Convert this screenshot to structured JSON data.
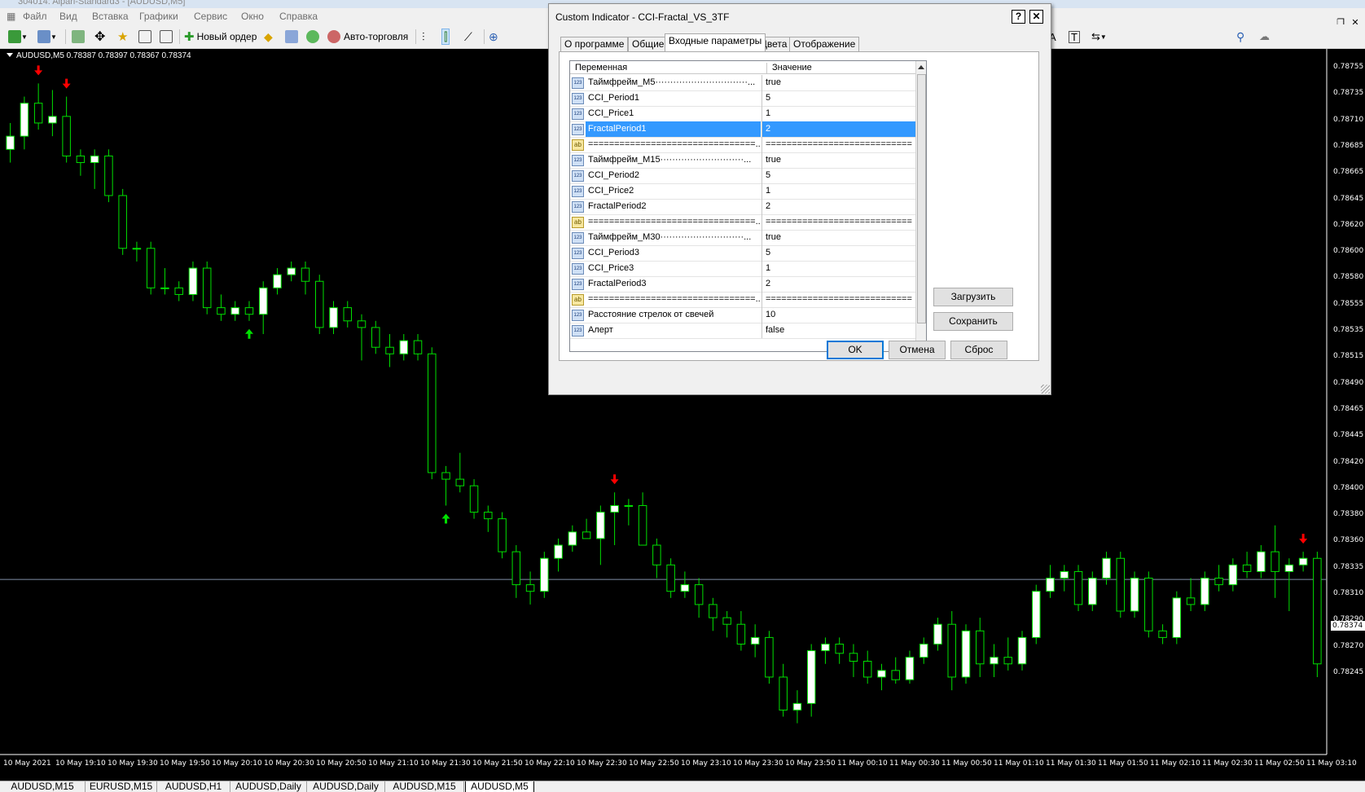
{
  "window": {
    "title": "304014: Alpari-Standard3 - [AUDUSD,M5]"
  },
  "menu": [
    "Файл",
    "Вид",
    "Вставка",
    "Графики",
    "Сервис",
    "Окно",
    "Справка"
  ],
  "toolbar": {
    "new_order": "Новый ордер",
    "auto_trading": "Авто-торговля"
  },
  "chart": {
    "symbol_label": "AUDUSD,M5  0.78387 0.78397 0.78367 0.78374",
    "bid": "0.78374",
    "colors": {
      "bull_body": "#ffffff",
      "bear_body": "#000000",
      "wick": "#00e000",
      "up_arrow": "#00e000",
      "down_arrow": "#ff0000",
      "bid_line": "#7f8fa8"
    },
    "price_labels": [
      "0.78755",
      "0.78735",
      "0.78710",
      "0.78685",
      "0.78665",
      "0.78645",
      "0.78620",
      "0.78600",
      "0.78580",
      "0.78555",
      "0.78535",
      "0.78515",
      "0.78490",
      "0.78465",
      "0.78445",
      "0.78420",
      "0.78400",
      "0.78380",
      "0.78360",
      "0.78335",
      "0.78310",
      "0.78290",
      "0.78270",
      "0.78245"
    ],
    "time_labels": [
      "10 May 2021",
      "10 May 19:10",
      "10 May 19:30",
      "10 May 19:50",
      "10 May 20:10",
      "10 May 20:30",
      "10 May 20:50",
      "10 May 21:10",
      "10 May 21:30",
      "10 May 21:50",
      "10 May 22:10",
      "10 May 22:30",
      "10 May 22:50",
      "10 May 23:10",
      "10 May 23:30",
      "10 May 23:50",
      "11 May 00:10",
      "11 May 00:30",
      "11 May 00:50",
      "11 May 01:10",
      "11 May 01:30",
      "11 May 01:50",
      "11 May 02:10",
      "11 May 02:30",
      "11 May 02:50",
      "11 May 03:10"
    ]
  },
  "chart_data": {
    "type": "candlestick",
    "symbol": "AUDUSD",
    "timeframe": "M5",
    "ylim": [
      0.78245,
      0.7877
    ],
    "candles": [
      [
        0.787,
        0.7872,
        0.7869,
        0.7871
      ],
      [
        0.7871,
        0.7874,
        0.787,
        0.78735
      ],
      [
        0.78735,
        0.7875,
        0.78715,
        0.7872
      ],
      [
        0.7872,
        0.78745,
        0.7871,
        0.78725
      ],
      [
        0.78725,
        0.7874,
        0.7869,
        0.78695
      ],
      [
        0.78695,
        0.787,
        0.7868,
        0.7869
      ],
      [
        0.7869,
        0.787,
        0.7867,
        0.78695
      ],
      [
        0.78695,
        0.787,
        0.7866,
        0.78665
      ],
      [
        0.78665,
        0.7867,
        0.7862,
        0.78625
      ],
      [
        0.78625,
        0.7863,
        0.78615,
        0.78625
      ],
      [
        0.78625,
        0.7863,
        0.7859,
        0.78595
      ],
      [
        0.78595,
        0.7861,
        0.7859,
        0.78595
      ],
      [
        0.78595,
        0.786,
        0.78585,
        0.7859
      ],
      [
        0.7859,
        0.78615,
        0.78585,
        0.7861
      ],
      [
        0.7861,
        0.78615,
        0.78575,
        0.7858
      ],
      [
        0.7858,
        0.7859,
        0.7857,
        0.78575
      ],
      [
        0.78575,
        0.78585,
        0.7857,
        0.7858
      ],
      [
        0.7858,
        0.78585,
        0.7857,
        0.78575
      ],
      [
        0.78575,
        0.786,
        0.7856,
        0.78595
      ],
      [
        0.78595,
        0.7861,
        0.7859,
        0.78605
      ],
      [
        0.78605,
        0.78615,
        0.786,
        0.7861
      ],
      [
        0.7861,
        0.78615,
        0.7859,
        0.786
      ],
      [
        0.786,
        0.78605,
        0.7856,
        0.78565
      ],
      [
        0.78565,
        0.78585,
        0.7856,
        0.7858
      ],
      [
        0.7858,
        0.78585,
        0.78565,
        0.7857
      ],
      [
        0.7857,
        0.78575,
        0.7854,
        0.78565
      ],
      [
        0.78565,
        0.7857,
        0.78545,
        0.7855
      ],
      [
        0.7855,
        0.7856,
        0.78535,
        0.78545
      ],
      [
        0.78545,
        0.7856,
        0.7854,
        0.78555
      ],
      [
        0.78555,
        0.7856,
        0.7854,
        0.78545
      ],
      [
        0.78545,
        0.7855,
        0.7845,
        0.78455
      ],
      [
        0.78455,
        0.7846,
        0.7843,
        0.7845
      ],
      [
        0.7845,
        0.7847,
        0.7844,
        0.78445
      ],
      [
        0.78445,
        0.7845,
        0.7842,
        0.78425
      ],
      [
        0.78425,
        0.7843,
        0.7841,
        0.7842
      ],
      [
        0.7842,
        0.78425,
        0.7839,
        0.78395
      ],
      [
        0.78395,
        0.784,
        0.7836,
        0.7837
      ],
      [
        0.7837,
        0.7838,
        0.78355,
        0.78365
      ],
      [
        0.78365,
        0.78395,
        0.7836,
        0.7839
      ],
      [
        0.7839,
        0.78405,
        0.7838,
        0.784
      ],
      [
        0.784,
        0.78415,
        0.78395,
        0.7841
      ],
      [
        0.7841,
        0.7842,
        0.78405,
        0.78405
      ],
      [
        0.78405,
        0.7843,
        0.78385,
        0.78425
      ],
      [
        0.78425,
        0.7844,
        0.784,
        0.7843
      ],
      [
        0.7843,
        0.78435,
        0.78415,
        0.7843
      ],
      [
        0.7843,
        0.7844,
        0.78405,
        0.784
      ],
      [
        0.784,
        0.78405,
        0.78375,
        0.78385
      ],
      [
        0.78385,
        0.7839,
        0.7836,
        0.78365
      ],
      [
        0.78365,
        0.7838,
        0.7836,
        0.7837
      ],
      [
        0.7837,
        0.78375,
        0.78345,
        0.78355
      ],
      [
        0.78355,
        0.7836,
        0.78335,
        0.78345
      ],
      [
        0.78345,
        0.7835,
        0.7833,
        0.7834
      ],
      [
        0.7834,
        0.7835,
        0.7832,
        0.78325
      ],
      [
        0.78325,
        0.7834,
        0.78315,
        0.7833
      ],
      [
        0.7833,
        0.78335,
        0.78295,
        0.783
      ],
      [
        0.783,
        0.7831,
        0.7827,
        0.78275
      ],
      [
        0.78275,
        0.7829,
        0.78265,
        0.7828
      ],
      [
        0.7828,
        0.78325,
        0.7827,
        0.7832
      ],
      [
        0.7832,
        0.7833,
        0.7831,
        0.78325
      ],
      [
        0.78325,
        0.7833,
        0.7831,
        0.78318
      ],
      [
        0.78318,
        0.78325,
        0.783,
        0.78312
      ],
      [
        0.78312,
        0.7832,
        0.78295,
        0.783
      ],
      [
        0.783,
        0.7831,
        0.7829,
        0.78305
      ],
      [
        0.78305,
        0.78315,
        0.78295,
        0.78298
      ],
      [
        0.78298,
        0.7832,
        0.78295,
        0.78315
      ],
      [
        0.78315,
        0.7833,
        0.7831,
        0.78325
      ],
      [
        0.78325,
        0.78345,
        0.7832,
        0.7834
      ],
      [
        0.7834,
        0.7835,
        0.7829,
        0.783
      ],
      [
        0.783,
        0.7834,
        0.78295,
        0.78335
      ],
      [
        0.78335,
        0.78345,
        0.783,
        0.7831
      ],
      [
        0.7831,
        0.78325,
        0.783,
        0.78315
      ],
      [
        0.78315,
        0.7833,
        0.78305,
        0.7831
      ],
      [
        0.7831,
        0.78335,
        0.78305,
        0.7833
      ],
      [
        0.7833,
        0.7837,
        0.78325,
        0.78365
      ],
      [
        0.78365,
        0.78385,
        0.7836,
        0.78375
      ],
      [
        0.78375,
        0.78385,
        0.78365,
        0.7838
      ],
      [
        0.7838,
        0.78385,
        0.7835,
        0.78355
      ],
      [
        0.78355,
        0.7838,
        0.7835,
        0.78375
      ],
      [
        0.78375,
        0.78395,
        0.7837,
        0.7839
      ],
      [
        0.7839,
        0.78395,
        0.78345,
        0.7835
      ],
      [
        0.7835,
        0.7838,
        0.78345,
        0.78375
      ],
      [
        0.78375,
        0.7838,
        0.7833,
        0.78335
      ],
      [
        0.78335,
        0.7834,
        0.78325,
        0.7833
      ],
      [
        0.7833,
        0.78365,
        0.78325,
        0.7836
      ],
      [
        0.7836,
        0.78375,
        0.7835,
        0.78355
      ],
      [
        0.78355,
        0.7838,
        0.7835,
        0.78375
      ],
      [
        0.78375,
        0.78385,
        0.78365,
        0.7837
      ],
      [
        0.7837,
        0.7839,
        0.78365,
        0.78385
      ],
      [
        0.78385,
        0.78395,
        0.78375,
        0.7838
      ],
      [
        0.7838,
        0.784,
        0.78375,
        0.78395
      ],
      [
        0.78395,
        0.78415,
        0.7836,
        0.7838
      ],
      [
        0.7838,
        0.7839,
        0.7835,
        0.78385
      ],
      [
        0.78385,
        0.78395,
        0.7838,
        0.7839
      ],
      [
        0.7839,
        0.78395,
        0.783,
        0.7831
      ]
    ],
    "signals": [
      {
        "type": "down",
        "index": 2
      },
      {
        "type": "down",
        "index": 4
      },
      {
        "type": "up",
        "index": 17
      },
      {
        "type": "up",
        "index": 31
      },
      {
        "type": "down",
        "index": 43
      },
      {
        "type": "down",
        "index": 92
      }
    ]
  },
  "dialog": {
    "title": "Custom Indicator - CCI-Fractal_VS_3TF",
    "help_btn": "?",
    "close_btn": "✕",
    "tabs": [
      "О программе",
      "Общие",
      "Входные параметры",
      "Цвета",
      "Отображение"
    ],
    "active_tab": 2,
    "col_var": "Переменная",
    "col_val": "Значение",
    "rows": [
      {
        "icon": "123",
        "name": "Таймфрейм_M5·······························...",
        "value": "true"
      },
      {
        "icon": "123",
        "name": "CCI_Period1",
        "value": "5"
      },
      {
        "icon": "123",
        "name": "CCI_Price1",
        "value": "1"
      },
      {
        "icon": "123",
        "name": "FractalPeriod1",
        "value": "2",
        "selected": true
      },
      {
        "icon": "ab",
        "name": "================================...",
        "value": "============================"
      },
      {
        "icon": "123",
        "name": "Таймфрейм_M15····························...",
        "value": "true"
      },
      {
        "icon": "123",
        "name": "CCI_Period2",
        "value": "5"
      },
      {
        "icon": "123",
        "name": "CCI_Price2",
        "value": "1"
      },
      {
        "icon": "123",
        "name": "FractalPeriod2",
        "value": "2"
      },
      {
        "icon": "ab",
        "name": "================================...",
        "value": "============================"
      },
      {
        "icon": "123",
        "name": "Таймфрейм_M30····························...",
        "value": "true"
      },
      {
        "icon": "123",
        "name": "CCI_Period3",
        "value": "5"
      },
      {
        "icon": "123",
        "name": "CCI_Price3",
        "value": "1"
      },
      {
        "icon": "123",
        "name": "FractalPeriod3",
        "value": "2"
      },
      {
        "icon": "ab",
        "name": "================================...",
        "value": "============================"
      },
      {
        "icon": "123",
        "name": "Расстояние стрелок от свечей",
        "value": "10"
      },
      {
        "icon": "123",
        "name": "Алерт",
        "value": "false"
      }
    ],
    "load_btn": "Загрузить",
    "save_btn": "Сохранить",
    "ok_btn": "OK",
    "cancel_btn": "Отмена",
    "reset_btn": "Сброс"
  },
  "chart_tabs": [
    "AUDUSD,M15",
    "EURUSD,M15",
    "AUDUSD,H1",
    "AUDUSD,Daily",
    "AUDUSD,Daily",
    "AUDUSD,M15",
    "AUDUSD,M5"
  ],
  "active_chart_tab": 6
}
